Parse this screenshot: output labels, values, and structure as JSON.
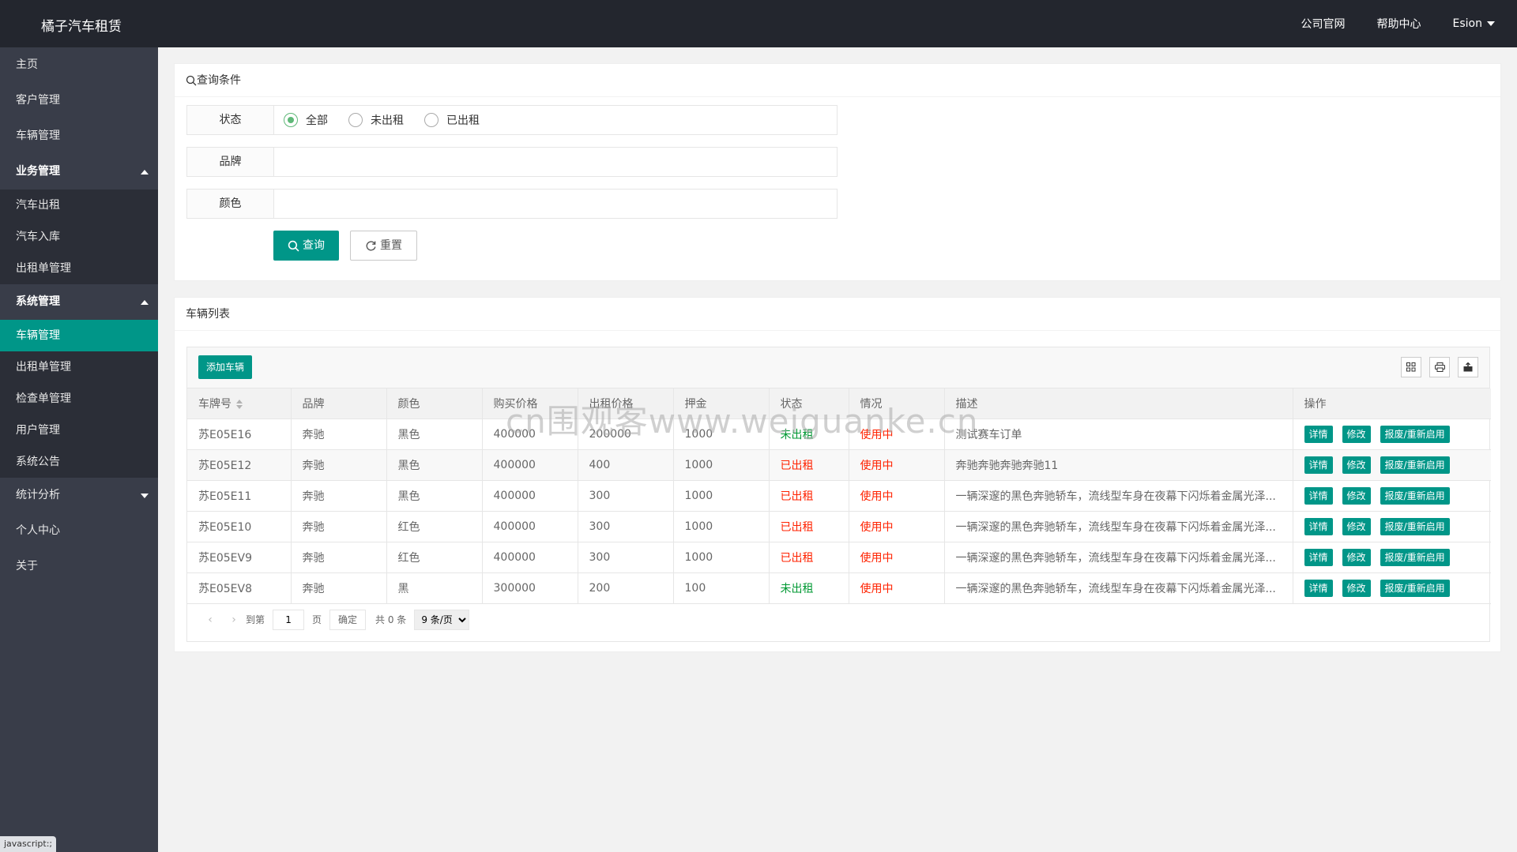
{
  "header": {
    "logo": "橘子汽车租赁",
    "nav": [
      "公司官网",
      "帮助中心"
    ],
    "user": "Esion"
  },
  "sidebar": {
    "items": [
      {
        "label": "主页"
      },
      {
        "label": "客户管理"
      },
      {
        "label": "车辆管理"
      },
      {
        "label": "业务管理",
        "group": true,
        "expanded": true
      },
      {
        "label": "汽车出租",
        "sub": true
      },
      {
        "label": "汽车入库",
        "sub": true
      },
      {
        "label": "出租单管理",
        "sub": true
      },
      {
        "label": "系统管理",
        "group": true,
        "expanded": true
      },
      {
        "label": "车辆管理",
        "sub": true,
        "active": true
      },
      {
        "label": "出租单管理",
        "sub": true
      },
      {
        "label": "检查单管理",
        "sub": true
      },
      {
        "label": "用户管理",
        "sub": true
      },
      {
        "label": "系统公告",
        "sub": true
      },
      {
        "label": "统计分析",
        "group": false,
        "expanded": false
      },
      {
        "label": "个人中心"
      },
      {
        "label": "关于"
      }
    ]
  },
  "status_bar": "javascript:;",
  "query": {
    "title": "查询条件",
    "status_label": "状态",
    "status_options": [
      "全部",
      "未出租",
      "已出租"
    ],
    "brand_label": "品牌",
    "brand_value": "",
    "color_label": "颜色",
    "color_value": "",
    "search_button": "查询",
    "reset_button": "重置"
  },
  "list": {
    "title": "车辆列表",
    "add_button": "添加车辆",
    "columns": [
      "车牌号",
      "品牌",
      "颜色",
      "购买价格",
      "出租价格",
      "押金",
      "状态",
      "情况",
      "描述",
      "操作"
    ],
    "rows": [
      {
        "plate": "苏E05E16",
        "brand": "奔驰",
        "color": "黑色",
        "buy": "400000",
        "rent": "200000",
        "deposit": "1000",
        "status": "未出租",
        "state": "使用中",
        "desc": "测试赛车订单"
      },
      {
        "plate": "苏E05E12",
        "brand": "奔驰",
        "color": "黑色",
        "buy": "400000",
        "rent": "400",
        "deposit": "1000",
        "status": "已出租",
        "state": "使用中",
        "desc": "奔驰奔驰奔驰奔驰11"
      },
      {
        "plate": "苏E05E11",
        "brand": "奔驰",
        "color": "黑色",
        "buy": "400000",
        "rent": "300",
        "deposit": "1000",
        "status": "已出租",
        "state": "使用中",
        "desc": "一辆深邃的黑色奔驰轿车，流线型车身在夜幕下闪烁着金属光泽..."
      },
      {
        "plate": "苏E05E10",
        "brand": "奔驰",
        "color": "红色",
        "buy": "400000",
        "rent": "300",
        "deposit": "1000",
        "status": "已出租",
        "state": "使用中",
        "desc": "一辆深邃的黑色奔驰轿车，流线型车身在夜幕下闪烁着金属光泽..."
      },
      {
        "plate": "苏E05EV9",
        "brand": "奔驰",
        "color": "红色",
        "buy": "400000",
        "rent": "300",
        "deposit": "1000",
        "status": "已出租",
        "state": "使用中",
        "desc": "一辆深邃的黑色奔驰轿车，流线型车身在夜幕下闪烁着金属光泽..."
      },
      {
        "plate": "苏E05EV8",
        "brand": "奔驰",
        "color": "黑",
        "buy": "300000",
        "rent": "200",
        "deposit": "100",
        "status": "未出租",
        "state": "使用中",
        "desc": "一辆深邃的黑色奔驰轿车，流线型车身在夜幕下闪烁着金属光泽..."
      }
    ],
    "actions": [
      "详情",
      "修改",
      "报废/重新启用"
    ],
    "status_colors": {
      "未出租": "#009933",
      "已出租": "#ff2200"
    }
  },
  "pager": {
    "goto": "到第",
    "page_value": "1",
    "page_unit": "页",
    "confirm": "确定",
    "total": "共 0 条",
    "page_size": "9 条/页"
  },
  "watermark": "cn围观客www.weiguanke.cn",
  "colors": {
    "accent": "#009688",
    "header": "#23262e",
    "sidebar": "#393d49"
  }
}
